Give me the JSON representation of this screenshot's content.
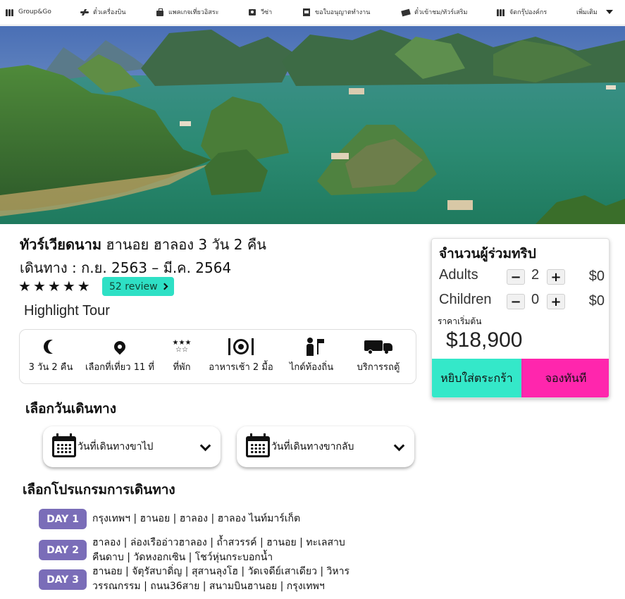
{
  "nav": {
    "brand": "Group&Go",
    "items": [
      {
        "label": "ตั๋วเครื่องบิน",
        "icon": "plane-icon"
      },
      {
        "label": "แพคเกจเที่ยวอิสระ",
        "icon": "luggage-icon"
      },
      {
        "label": "วีซ่า",
        "icon": "passport-icon"
      },
      {
        "label": "ขอใบอนุญาตทำงาน",
        "icon": "document-icon"
      },
      {
        "label": "ตั๋วเข้าชม/ทัวร์เสริม",
        "icon": "ticket-icon"
      },
      {
        "label": "จัดกรุ๊ปองค์กร",
        "icon": "group-icon"
      }
    ],
    "more_label": "เพิ่มเติม"
  },
  "hero": {
    "slide_count": 4,
    "active_slide": 1
  },
  "tour": {
    "title_bold": "ทัวร์เวียดนาม",
    "title_rest": "ฮานอย ฮาลอง 3 วัน 2 คืน",
    "dates": "เดินทาง : ก.ย. 2563 – มี.ค. 2564",
    "rating_stars": 5,
    "review_label": "52 review",
    "highlight_label": "Highlight Tour"
  },
  "features": [
    {
      "label": "3 วัน 2 คืน",
      "icon": "moon-icon"
    },
    {
      "label": "เลือกที่เที่ยว 11 ที่",
      "icon": "location-pin-icon"
    },
    {
      "label": "ที่พัก",
      "icon": "hotel-stars-icon"
    },
    {
      "label": "อาหารเช้า 2 มื้อ",
      "icon": "meal-icon"
    },
    {
      "label": "ไกด์ท้องถิ่น",
      "icon": "tour-guide-icon"
    },
    {
      "label": "บริการรถตู้",
      "icon": "van-icon"
    }
  ],
  "date_section": {
    "heading": "เลือกวันเดินทาง",
    "depart_label": "วันที่เดินทางขาไป",
    "return_label": "วันที่เดินทางขากลับ"
  },
  "program_section": {
    "heading": "เลือกโปรแกรมการเดินทาง",
    "days": [
      {
        "badge": "DAY 1",
        "lines": [
          "กรุงเทพฯ | ฮานอย | ฮาลอง | ฮาลอง ไนท์มาร์เก็ต"
        ]
      },
      {
        "badge": "DAY 2",
        "lines": [
          "ฮาลอง | ล่องเรืออ่าวฮาลอง | ถ้ำสวรรค์ |  ฮานอย | ทะเลสาบ",
          "คืนดาบ | วัดหงอกเซิน | โชว์หุ่นกระบอกน้ำ"
        ]
      },
      {
        "badge": "DAY 3",
        "lines": [
          "ฮานอย | จัตุรัสบาดิ่ญ | สุสานลุงโฮ | วัดเจดีย์เสาเดียว | วิหาร",
          "วรรณกรรม | ถนน36สาย | สนามบินฮานอย | กรุงเทพฯ"
        ]
      }
    ]
  },
  "booking": {
    "title": "จำนวนผู้ร่วมทริป",
    "adults_label": "Adults",
    "adults_qty": "2",
    "adults_subtotal": "$0",
    "children_label": "Children",
    "children_qty": "0",
    "children_subtotal": "$0",
    "minus": "−",
    "plus": "+",
    "price_from_label": "ราคาเริ่มต้น",
    "price": "$18,900",
    "add_to_cart": "หยิบใส่ตระกร้า",
    "book_now": "จองทันที"
  },
  "colors": {
    "teal": "#2ee0c5",
    "pink": "#ff26ad",
    "day_badge": "#7a6db8"
  }
}
